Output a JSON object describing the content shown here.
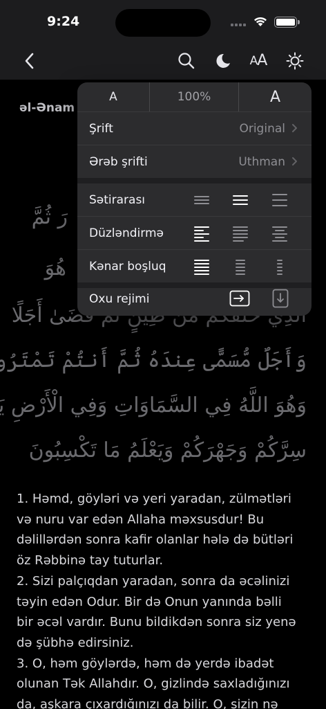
{
  "status_bar": {
    "time": "9:24"
  },
  "nav": {
    "back_icon": "chevron-left-icon",
    "search_icon": "search-icon",
    "night_icon": "moon-icon",
    "text_size_label_small": "A",
    "text_size_label_large": "A",
    "brightness_icon": "sun-icon"
  },
  "content": {
    "surah_title": "əl-Ənam",
    "arabic_lines": [
      "الَّذِي خَلَقَكُم مِّن طِينٍ ثُمَّ قَضَىٰ أَجَلًا",
      "وَأَجَلٌ مُّسَمًّى عِندَهُ ثُمَّ أَنتُمْ تَمْتَرُونَ ۞",
      "وَهُوَ اللَّهُ فِي السَّمَاوَاتِ وَفِي الْأَرْضِ يَعْلَمُ",
      "سِرَّكُمْ وَجَهْرَكُمْ وَيَعْلَمُ مَا تَكْسِبُونَ"
    ],
    "arabic_fragments": [
      "رَ ثُمَّ",
      "هُوَ"
    ],
    "translation_lines": [
      "1. Həmd, göyləri və yeri yaradan, zülmətləri",
      "və nuru var edən Allaha məxsusdur! Bu",
      "dəlillərdən sonra kafir olanlar hələ də bütləri",
      "öz Rəbbinə tay tuturlar.",
      "2. Sizi palçıqdan yaradan, sonra da əcəlinizi",
      "təyin edən Odur. Bir də Onun yanında bəlli",
      "bir əcəl vardır. Bunu bildikdən sonra siz yenə",
      "də şübhə edirsiniz.",
      "3. O, həm göylərdə, həm də yerdə ibadət",
      "olunan Tək Allahdır. O, gizlində saxladığınızı",
      "da, aşkara çıxardığınızı da bilir. O, sizin nə"
    ]
  },
  "popover": {
    "decrease_label": "A",
    "size_value": "100%",
    "increase_label": "A",
    "font_row": {
      "label": "Şrift",
      "value": "Original"
    },
    "arabic_font_row": {
      "label": "Ərəb şrifti",
      "value": "Uthman"
    },
    "line_spacing_row": {
      "label": "Sətirarası",
      "selected": "medium"
    },
    "alignment_row": {
      "label": "Düzləndirmə",
      "selected": "left"
    },
    "margin_row": {
      "label": "Kənar boşluq",
      "selected": "narrow"
    },
    "reading_mode_row": {
      "label": "Oxu rejimi",
      "options": [
        "horizontal-scroll-icon",
        "vertical-scroll-icon"
      ]
    }
  },
  "colors": {
    "background": "#000000",
    "surface": "#1c1c1e",
    "popover": "#2c2c2e",
    "secondary_text": "#8e8e93"
  }
}
